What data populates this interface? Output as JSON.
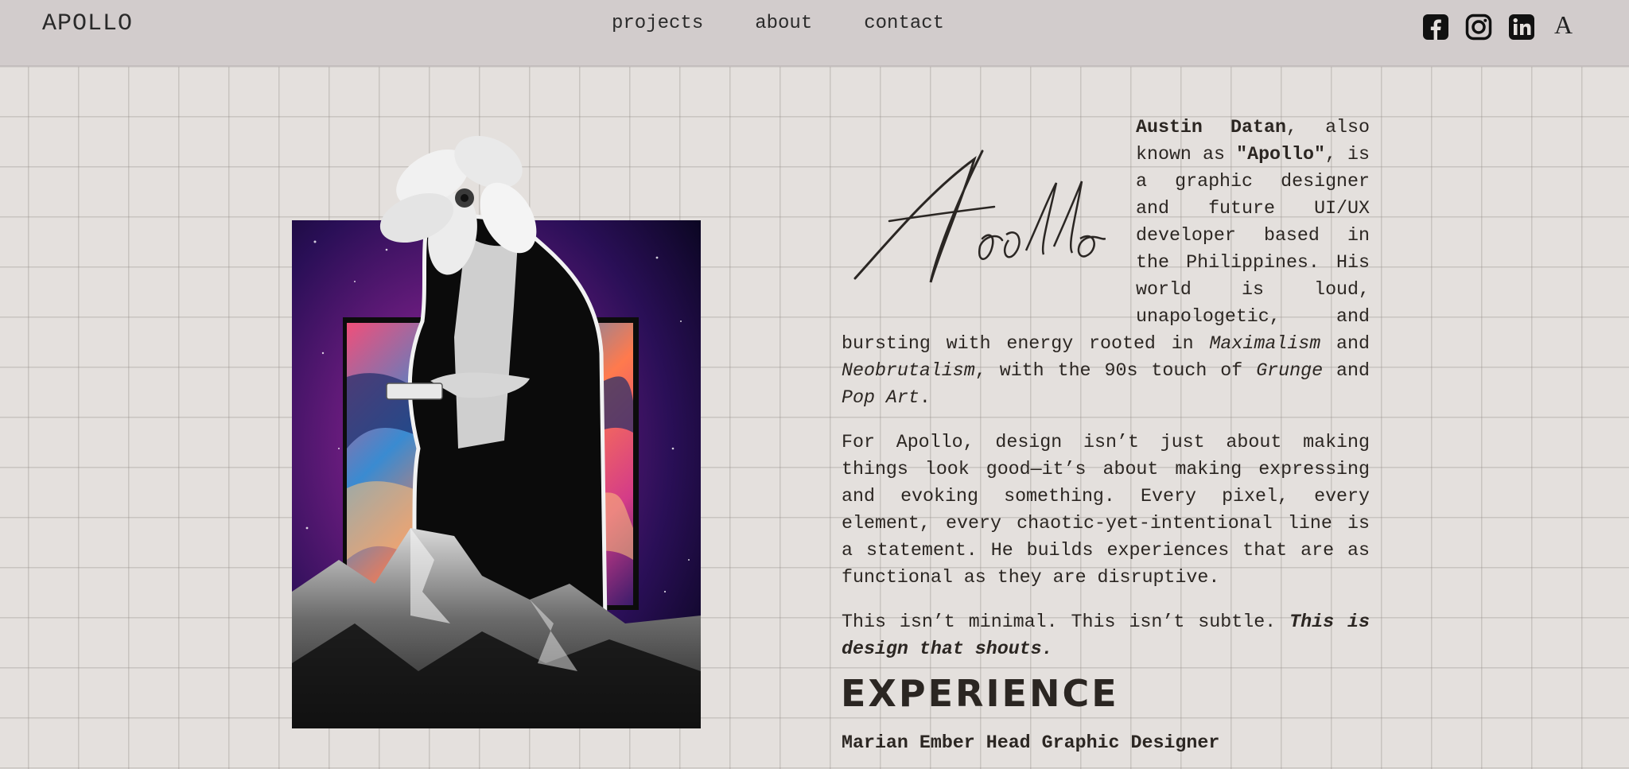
{
  "brand": "APOLLO",
  "nav": {
    "links": [
      "projects",
      "about",
      "contact"
    ]
  },
  "social": [
    "facebook-icon",
    "instagram-icon",
    "linkedin-icon"
  ],
  "accessibility": {
    "label": "A"
  },
  "signature": "Apollo",
  "bio": {
    "name": "Austin Datan",
    "p1_a": ", also known as ",
    "nickname": "\"Apollo\"",
    "p1_b": ", is a graphic designer and future UI/UX developer based in the Philippines. His world is loud, unapologetic, and bursting with energy rooted in ",
    "style1": "Maximalism",
    "and1": " and ",
    "style2": "Neobrutalism",
    "p1_c": ", with the 90s touch of ",
    "style3": "Grunge",
    "and2": " and ",
    "style4": "Pop Art",
    "p1_end": ".",
    "p2": "For Apollo, design isn’t just about making things look good—it’s about making expressing and evoking something. Every pixel, every element, every chaotic-yet-intentional line is a statement. He builds experiences that are as functional as they are disruptive.",
    "p3_a": "This isn’t minimal. This isn’t subtle. ",
    "p3_b": "This is design that shouts."
  },
  "experience": {
    "heading": "EXPERIENCE",
    "role": "Marian Ember Head Graphic Designer"
  }
}
